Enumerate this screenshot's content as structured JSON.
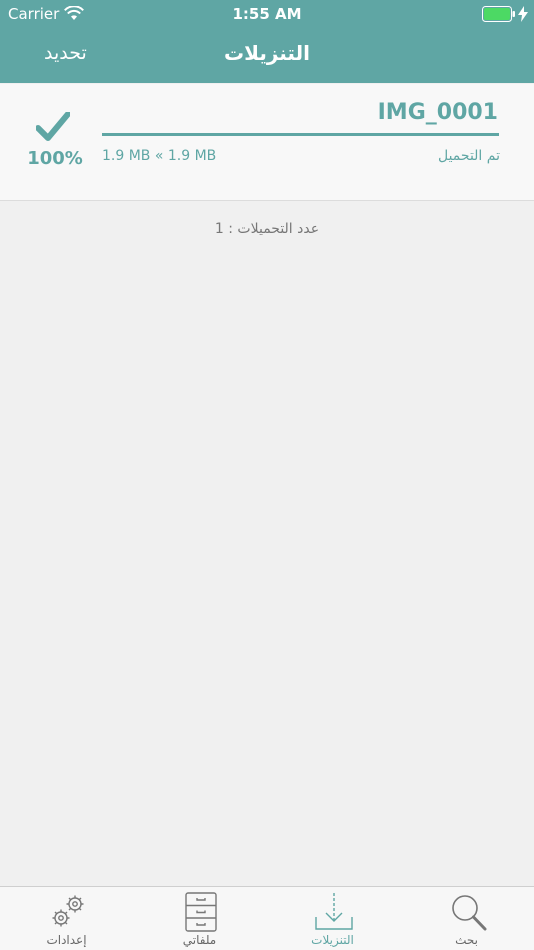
{
  "status_bar": {
    "carrier": "Carrier",
    "time": "1:55 AM",
    "battery_color": "#4cd964"
  },
  "nav": {
    "title": "التنزيلات",
    "refresh_label": "تحديد"
  },
  "download": {
    "file_name": "IMG_0001",
    "percent": "100%",
    "progress": 1.0,
    "size": "1.9 MB « 1.9 MB",
    "status": "تم التحميل"
  },
  "count_label": "عدد التحميلات : 1",
  "tabs": [
    {
      "label": "إعدادات",
      "icon": "gears-icon"
    },
    {
      "label": "ملفاتي",
      "icon": "cabinet-icon"
    },
    {
      "label": "التنزيلات",
      "icon": "download-icon"
    },
    {
      "label": "بحث",
      "icon": "search-icon"
    }
  ],
  "colors": {
    "accent": "#5fa6a4",
    "background": "#f0f0f0"
  }
}
